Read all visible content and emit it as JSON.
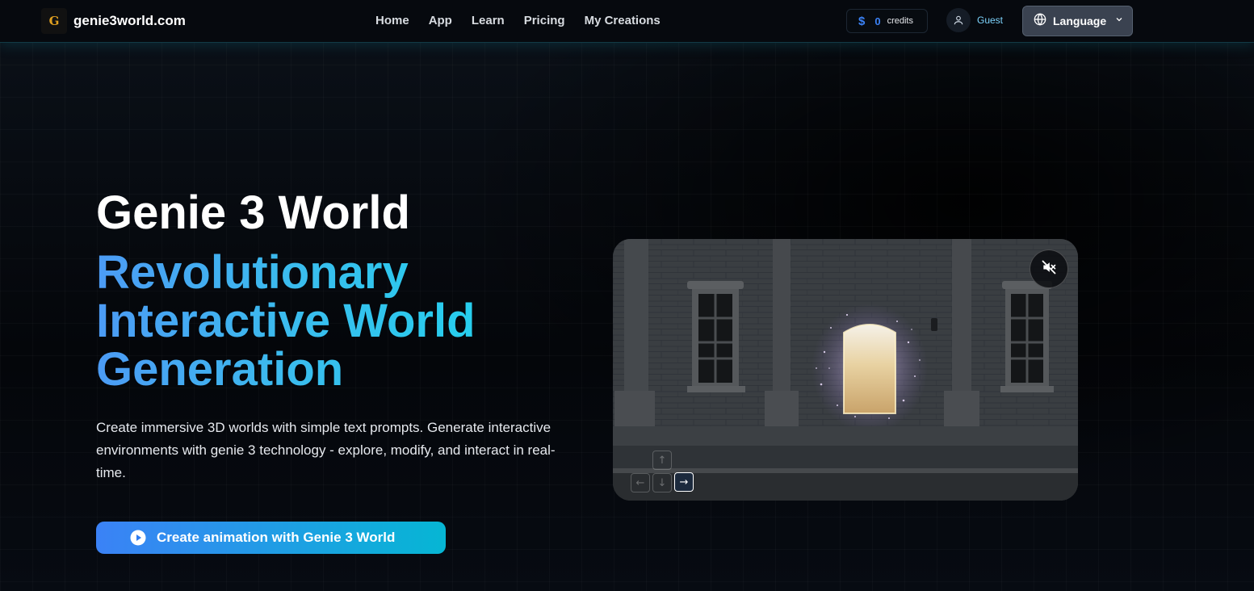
{
  "nav": {
    "logo_letter": "G",
    "brand": "genie3world.com",
    "menu": [
      "Home",
      "App",
      "Learn",
      "Pricing",
      "My Creations"
    ],
    "credits": {
      "symbol": "$",
      "count": "0",
      "label": "credits"
    },
    "user": "Guest",
    "language_label": "Language"
  },
  "hero": {
    "title": "Genie 3 World",
    "subtitle_line1": "Revolutionary",
    "subtitle_line2_a": "Interactive ",
    "subtitle_line2_b": "World",
    "subtitle_line3": "Generation",
    "description": "Create immersive 3D worlds with simple text prompts. Generate interactive environments with genie 3 technology - explore, modify, and interact in real-time.",
    "cta_label": "Create animation with Genie 3 World"
  },
  "video": {
    "muted": true,
    "controls": {
      "up": "↑",
      "left": "←",
      "down": "↓",
      "right": "→",
      "active": "right"
    }
  },
  "colors": {
    "accent_blue": "#3b82f6",
    "accent_cyan": "#06b6d4",
    "guest_text": "#7dd3fc"
  }
}
